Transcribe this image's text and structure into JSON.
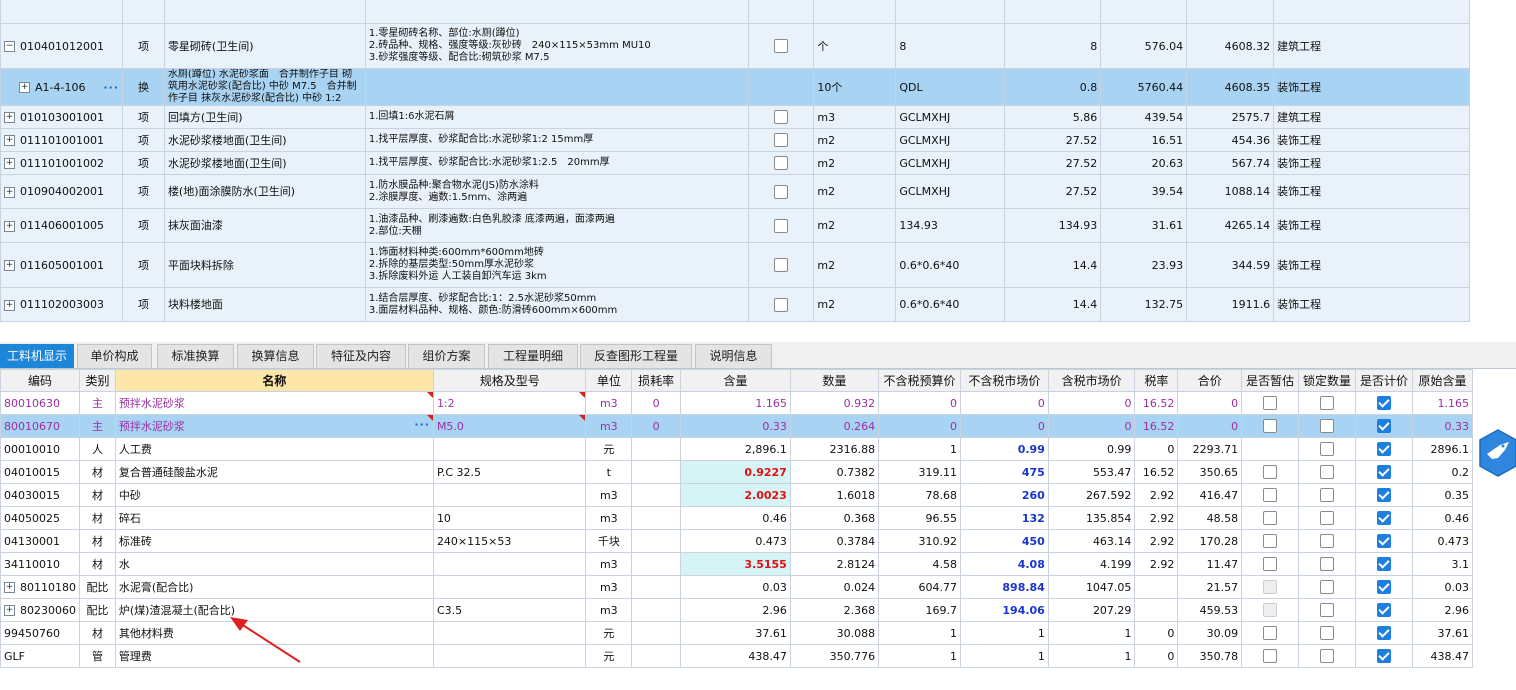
{
  "top_rows": [
    {
      "code": "",
      "type": "",
      "name": "",
      "spec": "",
      "sel": false,
      "unit": "",
      "expr": "",
      "qty": "",
      "price": "",
      "total": "",
      "major": "",
      "partial": true
    },
    {
      "code": "010401012001",
      "type": "项",
      "name": "零星砌砖(卫生间)",
      "spec": "1.零星砌砖名称、部位:水厕(蹲位)\n2.砖品种、规格、强度等级:灰砂砖　240×115×53mm MU10\n3.砂浆强度等级、配合比:砌筑砂浆 M7.5",
      "unit": "个",
      "expr": "8",
      "qty": "8",
      "price": "576.04",
      "total": "4608.32",
      "major": "建筑工程",
      "exp": "−"
    },
    {
      "code": "A1-4-106",
      "type": "换",
      "name": "水厕(蹲位) 水泥砂浆面　合并制作子目 砌筑用水泥砂浆(配合比) 中砂 M7.5　合并制作子目 抹灰水泥砂浆(配合比) 中砂 1:2",
      "spec": "",
      "unit": "10个",
      "expr": "QDL",
      "qty": "0.8",
      "price": "5760.44",
      "total": "4608.35",
      "major": "装饰工程",
      "sel": true,
      "dots": "···",
      "exp": "+"
    },
    {
      "code": "010103001001",
      "type": "项",
      "name": "回填方(卫生间)",
      "spec": "1.回填1:6水泥石屑",
      "unit": "m3",
      "expr": "GCLMXHJ",
      "qty": "5.86",
      "price": "439.54",
      "total": "2575.7",
      "major": "建筑工程",
      "exp": "+"
    },
    {
      "code": "011101001001",
      "type": "项",
      "name": "水泥砂浆楼地面(卫生间)",
      "spec": "1.找平层厚度、砂浆配合比:水泥砂浆1:2 15mm厚",
      "unit": "m2",
      "expr": "GCLMXHJ",
      "qty": "27.52",
      "price": "16.51",
      "total": "454.36",
      "major": "装饰工程",
      "exp": "+"
    },
    {
      "code": "011101001002",
      "type": "项",
      "name": "水泥砂浆楼地面(卫生间)",
      "spec": "1.找平层厚度、砂浆配合比:水泥砂浆1:2.5　20mm厚",
      "unit": "m2",
      "expr": "GCLMXHJ",
      "qty": "27.52",
      "price": "20.63",
      "total": "567.74",
      "major": "装饰工程",
      "exp": "+"
    },
    {
      "code": "010904002001",
      "type": "项",
      "name": "楼(地)面涂膜防水(卫生间)",
      "spec": "1.防水膜品种:聚合物水泥(JS)防水涂料\n2.涂膜厚度、遍数:1.5mm、涂两遍",
      "unit": "m2",
      "expr": "GCLMXHJ",
      "qty": "27.52",
      "price": "39.54",
      "total": "1088.14",
      "major": "装饰工程",
      "exp": "+"
    },
    {
      "code": "011406001005",
      "type": "项",
      "name": "抹灰面油漆",
      "spec": "1.油漆品种、刷漆遍数:白色乳胶漆 底漆两遍，面漆两遍\n2.部位:天棚",
      "unit": "m2",
      "expr": "134.93",
      "qty": "134.93",
      "price": "31.61",
      "total": "4265.14",
      "major": "装饰工程",
      "exp": "+"
    },
    {
      "code": "011605001001",
      "type": "项",
      "name": "平面块料拆除",
      "spec": "1.饰面材料种类:600mm*600mm地砖\n2.拆除的基层类型:50mm厚水泥砂浆\n3.拆除废料外运 人工装自卸汽车运 3km",
      "unit": "m2",
      "expr": "0.6*0.6*40",
      "qty": "14.4",
      "price": "23.93",
      "total": "344.59",
      "major": "装饰工程",
      "exp": "+"
    },
    {
      "code": "011102003003",
      "type": "项",
      "name": "块料楼地面",
      "spec": "1.结合层厚度、砂浆配合比:1：2.5水泥砂浆50mm\n3.面层材料品种、规格、颜色:防滑砖600mm×600mm",
      "unit": "m2",
      "expr": "0.6*0.6*40",
      "qty": "14.4",
      "price": "132.75",
      "total": "1911.6",
      "major": "装饰工程",
      "exp": "+"
    }
  ],
  "tabs": [
    "工料机显示",
    "单价构成",
    "标准换算",
    "换算信息",
    "特征及内容",
    "组价方案",
    "工程量明细",
    "反查图形工程量",
    "说明信息"
  ],
  "headers": [
    "编码",
    "类别",
    "名称",
    "规格及型号",
    "单位",
    "损耗率",
    "含量",
    "数量",
    "不含税预算价",
    "不含税市场价",
    "含税市场价",
    "税率",
    "合价",
    "是否暂估",
    "锁定数量",
    "是否计价",
    "原始含量"
  ],
  "rows": [
    {
      "code": "80010630",
      "cat": "主",
      "name": "预拌水泥砂浆",
      "spec": "1:2",
      "unit": "m3",
      "loss": "0",
      "content": "1.165",
      "qty": "0.932",
      "budget": "0",
      "market": "0",
      "taxm": "0",
      "tax": "16.52",
      "total": "0",
      "est": false,
      "lock": false,
      "price": true,
      "orig": "1.165",
      "style": "pur"
    },
    {
      "code": "80010670",
      "cat": "主",
      "name": "预拌水泥砂浆",
      "spec": "M5.0",
      "unit": "m3",
      "loss": "0",
      "content": "0.33",
      "qty": "0.264",
      "budget": "0",
      "market": "0",
      "taxm": "0",
      "tax": "16.52",
      "total": "0",
      "est": false,
      "lock": false,
      "price": true,
      "orig": "0.33",
      "style": "pur sel",
      "dots": "···"
    },
    {
      "code": "00010010",
      "cat": "人",
      "name": "人工费",
      "spec": "",
      "unit": "元",
      "loss": "",
      "content": "2,896.1",
      "qty": "2316.88",
      "budget": "1",
      "market": "0.99",
      "taxm": "0.99",
      "tax": "0",
      "total": "2293.71",
      "est": null,
      "lock": false,
      "price": true,
      "orig": "2896.1",
      "mstyle": "blue"
    },
    {
      "code": "04010015",
      "cat": "材",
      "name": "复合普通硅酸盐水泥",
      "spec": "P.C 32.5",
      "unit": "t",
      "loss": "",
      "content": "0.9227",
      "qty": "0.7382",
      "budget": "319.11",
      "market": "475",
      "taxm": "553.47",
      "tax": "16.52",
      "total": "350.65",
      "est": false,
      "lock": false,
      "price": true,
      "orig": "0.2",
      "cstyle": "red",
      "mstyle": "blue"
    },
    {
      "code": "04030015",
      "cat": "材",
      "name": "中砂",
      "spec": "",
      "unit": "m3",
      "loss": "",
      "content": "2.0023",
      "qty": "1.6018",
      "budget": "78.68",
      "market": "260",
      "taxm": "267.592",
      "tax": "2.92",
      "total": "416.47",
      "est": false,
      "lock": false,
      "price": true,
      "orig": "0.35",
      "cstyle": "red",
      "mstyle": "blue"
    },
    {
      "code": "04050025",
      "cat": "材",
      "name": "碎石",
      "spec": "10",
      "unit": "m3",
      "loss": "",
      "content": "0.46",
      "qty": "0.368",
      "budget": "96.55",
      "market": "132",
      "taxm": "135.854",
      "tax": "2.92",
      "total": "48.58",
      "est": false,
      "lock": false,
      "price": true,
      "orig": "0.46",
      "mstyle": "blue"
    },
    {
      "code": "04130001",
      "cat": "材",
      "name": "标准砖",
      "spec": "240×115×53",
      "unit": "千块",
      "loss": "",
      "content": "0.473",
      "qty": "0.3784",
      "budget": "310.92",
      "market": "450",
      "taxm": "463.14",
      "tax": "2.92",
      "total": "170.28",
      "est": false,
      "lock": false,
      "price": true,
      "orig": "0.473",
      "mstyle": "blue"
    },
    {
      "code": "34110010",
      "cat": "材",
      "name": "水",
      "spec": "",
      "unit": "m3",
      "loss": "",
      "content": "3.5155",
      "qty": "2.8124",
      "budget": "4.58",
      "market": "4.08",
      "taxm": "4.199",
      "tax": "2.92",
      "total": "11.47",
      "est": false,
      "lock": false,
      "price": true,
      "orig": "3.1",
      "cstyle": "red",
      "mstyle": "blue"
    },
    {
      "code": "80110180",
      "cat": "配比",
      "name": "水泥膏(配合比)",
      "spec": "",
      "unit": "m3",
      "loss": "",
      "content": "0.03",
      "qty": "0.024",
      "budget": "604.77",
      "market": "898.84",
      "taxm": "1047.05",
      "tax": "",
      "total": "21.57",
      "est": "dis",
      "lock": false,
      "price": true,
      "orig": "0.03",
      "mstyle": "blue",
      "exp": "+"
    },
    {
      "code": "80230060",
      "cat": "配比",
      "name": "炉(煤)渣混凝土(配合比)",
      "spec": "C3.5",
      "unit": "m3",
      "loss": "",
      "content": "2.96",
      "qty": "2.368",
      "budget": "169.7",
      "market": "194.06",
      "taxm": "207.29",
      "tax": "",
      "total": "459.53",
      "est": "dis",
      "lock": false,
      "price": true,
      "orig": "2.96",
      "mstyle": "blue",
      "exp": "+"
    },
    {
      "code": "99450760",
      "cat": "材",
      "name": "其他材料费",
      "spec": "",
      "unit": "元",
      "loss": "",
      "content": "37.61",
      "qty": "30.088",
      "budget": "1",
      "market": "1",
      "taxm": "1",
      "tax": "0",
      "total": "30.09",
      "est": false,
      "lock": false,
      "price": true,
      "orig": "37.61"
    },
    {
      "code": "GLF",
      "cat": "管",
      "name": "管理费",
      "spec": "",
      "unit": "元",
      "loss": "",
      "content": "438.47",
      "qty": "350.776",
      "budget": "1",
      "market": "1",
      "taxm": "1",
      "tax": "0",
      "total": "350.78",
      "est": false,
      "lock": false,
      "price": true,
      "orig": "438.47"
    }
  ],
  "colors": {
    "tab_active": "#1e86d8",
    "selected_row": "#a9d3f3",
    "top_grid": "#e9f1fb",
    "main_material": "#9c2fa5",
    "red_value": "#e01010",
    "blue_value": "#1a34d0",
    "arrow": "#e02020"
  }
}
